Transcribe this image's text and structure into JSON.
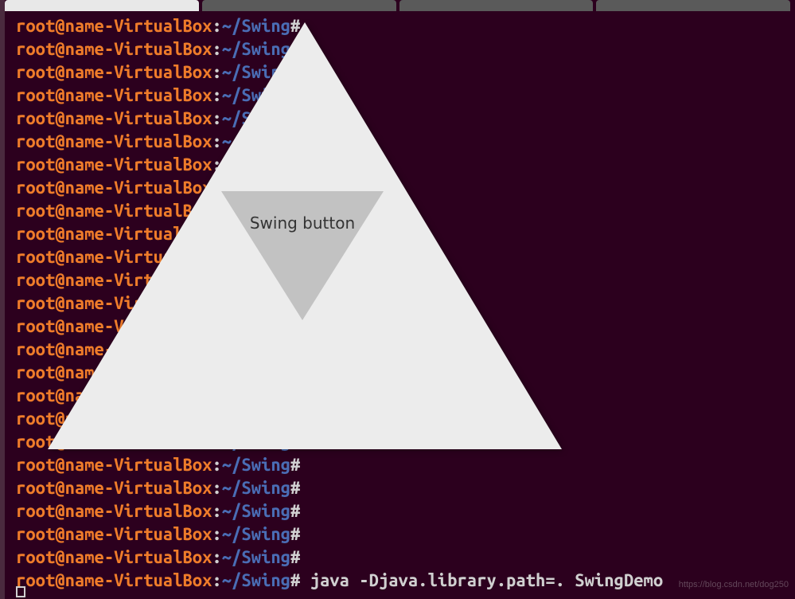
{
  "tabs": [
    {
      "label": "",
      "active": true
    },
    {
      "label": "",
      "active": false
    },
    {
      "label": "",
      "active": false
    },
    {
      "label": "",
      "active": false
    }
  ],
  "prompt": {
    "user_host": "root@name-VirtualBox",
    "colon": ":",
    "path": "~/Swing",
    "hash": "#"
  },
  "lines": [
    {
      "cmd": ""
    },
    {
      "cmd": ""
    },
    {
      "cmd": ""
    },
    {
      "cmd": ""
    },
    {
      "cmd": ""
    },
    {
      "cmd": ""
    },
    {
      "cmd": ""
    },
    {
      "cmd": ""
    },
    {
      "cmd": ""
    },
    {
      "cmd": ""
    },
    {
      "cmd": ""
    },
    {
      "cmd": ""
    },
    {
      "cmd": ""
    },
    {
      "cmd": ""
    },
    {
      "cmd": ""
    },
    {
      "cmd": ""
    },
    {
      "cmd": ""
    },
    {
      "cmd": ""
    },
    {
      "cmd": ""
    },
    {
      "cmd": ""
    },
    {
      "cmd": ""
    },
    {
      "cmd": ""
    },
    {
      "cmd": ""
    },
    {
      "cmd": ""
    },
    {
      "cmd": " java -Djava.library.path=. SwingDemo"
    }
  ],
  "swing": {
    "button_label": "Swing button"
  },
  "watermark": "https://blog.csdn.net/dog250"
}
